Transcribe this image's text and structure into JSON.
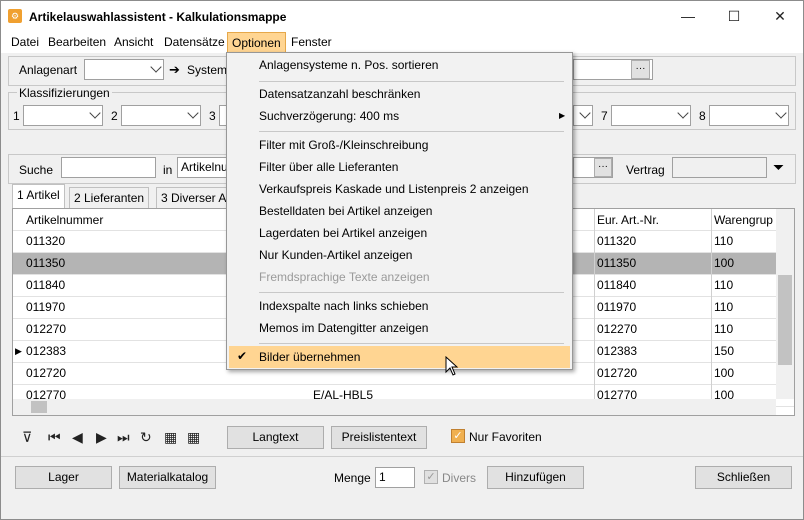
{
  "window": {
    "title": "Artikelauswahlassistent - Kalkulationsmappe",
    "minimize": "—",
    "maximize": "☐",
    "close": "✕",
    "icon": "app-icon"
  },
  "menubar": [
    "Datei",
    "Bearbeiten",
    "Ansicht",
    "Datensätze",
    "Optionen",
    "Fenster"
  ],
  "filters": {
    "anlagenart_label": "Anlagenart",
    "arrow": "➔",
    "systeme_label": "System",
    "klassifizierungen_label": "Klassifizierungen",
    "slots": [
      "1",
      "2",
      "3",
      "7",
      "8"
    ]
  },
  "search": {
    "suche_label": "Suche",
    "suche_value": "",
    "in_label": "in",
    "in_value": "Artikelnu",
    "vertrag_label": "Vertrag"
  },
  "tabs": [
    "1 Artikel",
    "2 Lieferanten",
    "3 Diverser A"
  ],
  "table": {
    "headers": [
      "Artikelnummer",
      "Eur. Art.-Nr.",
      "Warengrup"
    ],
    "rows": [
      {
        "nr": "011320",
        "mid": "",
        "eur": "011320",
        "wg": "110"
      },
      {
        "nr": "011350",
        "mid": "",
        "eur": "011350",
        "wg": "100"
      },
      {
        "nr": "011840",
        "mid": "",
        "eur": "011840",
        "wg": "110"
      },
      {
        "nr": "011970",
        "mid": "",
        "eur": "011970",
        "wg": "110"
      },
      {
        "nr": "012270",
        "mid": "",
        "eur": "012270",
        "wg": "110"
      },
      {
        "nr": "012383",
        "mid": "",
        "eur": "012383",
        "wg": "150"
      },
      {
        "nr": "012720",
        "mid": "",
        "eur": "012720",
        "wg": "100"
      },
      {
        "nr": "012770",
        "mid": "E/AL-HBL5",
        "eur": "012770",
        "wg": "100"
      }
    ]
  },
  "toolbar": {
    "langtext": "Langtext",
    "preislistentext": "Preislistentext",
    "nur_favoriten": "Nur Favoriten"
  },
  "bottom": {
    "lager": "Lager",
    "materialkatalog": "Materialkatalog",
    "menge_label": "Menge",
    "menge_value": "1",
    "divers_label": "Divers",
    "hinzufuegen": "Hinzufügen",
    "schliessen": "Schließen"
  },
  "optionen_menu": [
    "Anlagensysteme n. Pos. sortieren",
    "Datensatzanzahl beschränken",
    "Suchverzögerung: 400 ms",
    "Filter mit Groß-/Kleinschreibung",
    "Filter über alle Lieferanten",
    "Verkaufspreis Kaskade und Listenpreis 2 anzeigen",
    "Bestelldaten bei Artikel anzeigen",
    "Lagerdaten bei Artikel anzeigen",
    "Nur Kunden-Artikel anzeigen",
    "Fremdsprachige Texte anzeigen",
    "Indexspalte nach links schieben",
    "Memos im Datengitter anzeigen",
    "Bilder übernehmen"
  ],
  "colors": {
    "highlight": "#ffd592",
    "selected_row": "#b4b4b4",
    "menu_bg": "#f2f2f2"
  }
}
